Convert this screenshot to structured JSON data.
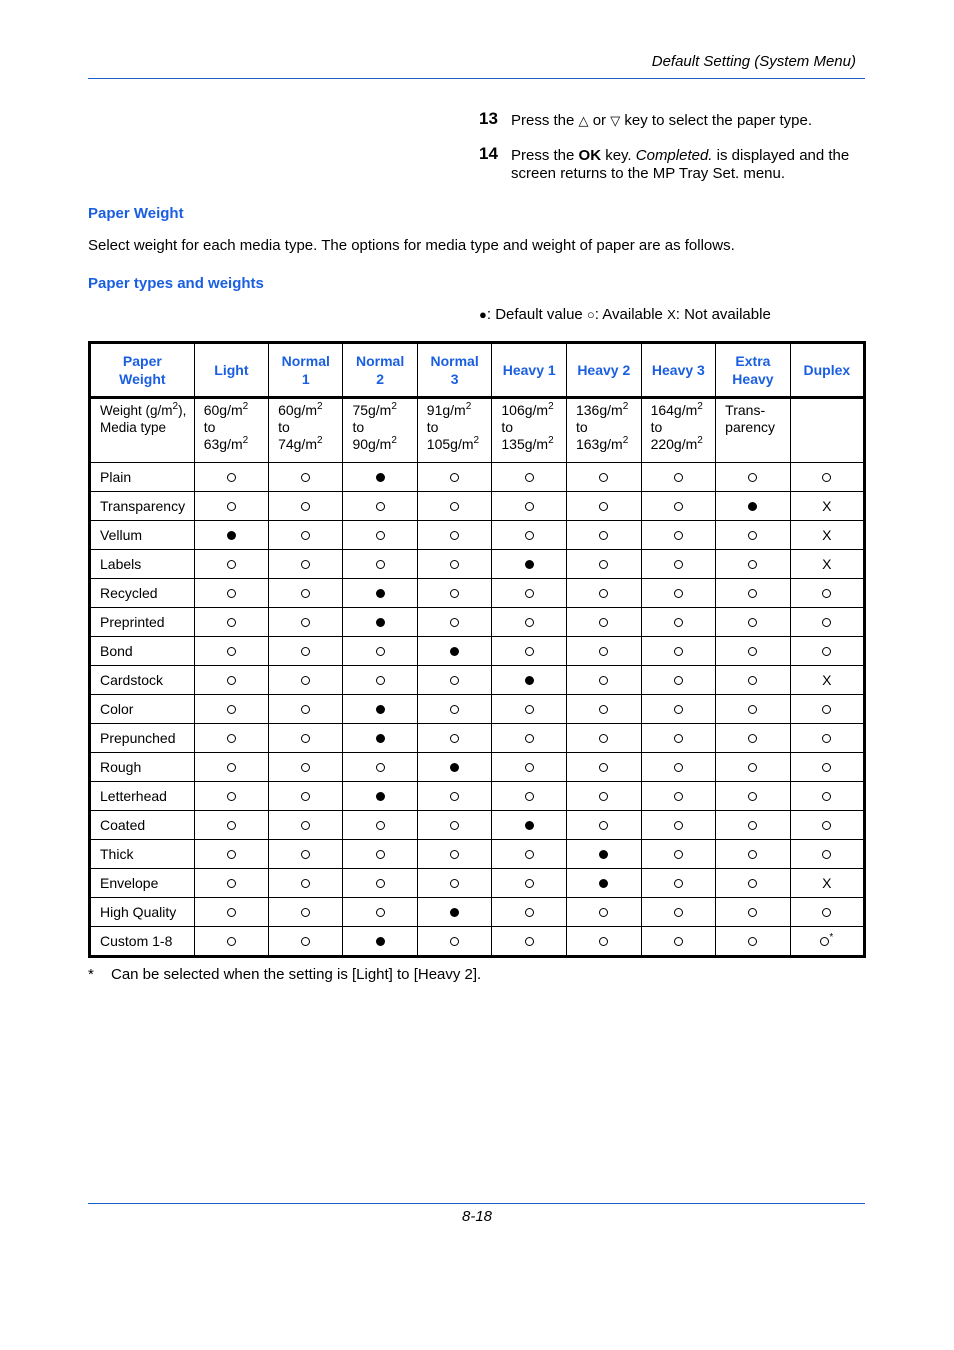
{
  "header": {
    "title": "Default Setting (System Menu)"
  },
  "steps": [
    {
      "num": "13",
      "before": "Press the ",
      "up_key": "△",
      "mid": " or ",
      "down_key": "▽",
      "after": " key to select the paper type."
    },
    {
      "num": "14",
      "before": "Press the ",
      "ok": "OK",
      "mid": " key. ",
      "completed": "Completed.",
      "after": " is displayed and the screen returns to the MP Tray Set. menu."
    }
  ],
  "sections": {
    "paper_weight_heading": "Paper Weight",
    "intro": "Select weight for each media type. The options for media type and weight of paper are as follows.",
    "table_heading": "Paper types and weights"
  },
  "legend": {
    "default_symbol": "●",
    "default_label": ": Default value ",
    "available_symbol": "○",
    "available_label": ": Available ",
    "na_symbol": "X",
    "na_label": ": Not available"
  },
  "table": {
    "headers": [
      [
        "Paper",
        "Weight"
      ],
      [
        "Light"
      ],
      [
        "Normal",
        "1"
      ],
      [
        "Normal",
        "2"
      ],
      [
        "Normal",
        "3"
      ],
      [
        "Heavy 1"
      ],
      [
        "Heavy 2"
      ],
      [
        "Heavy 3"
      ],
      [
        "Extra",
        "Heavy"
      ],
      [
        "Duplex"
      ]
    ],
    "weights_row": {
      "label_line1": "Weight (g/m",
      "label_sup": "2",
      "label_line1_end": "),",
      "label_line2": "Media type",
      "ranges": [
        {
          "from": "60g/m",
          "to_word": "to",
          "to": "63g/m"
        },
        {
          "from": "60g/m",
          "to_word": "to",
          "to": "74g/m"
        },
        {
          "from": "75g/m",
          "to_word": "to",
          "to": "90g/m"
        },
        {
          "from": "91g/m",
          "to_word": "to",
          "to": "105g/m"
        },
        {
          "from": "106g/m",
          "to_word": "to",
          "to": "135g/m"
        },
        {
          "from": "136g/m",
          "to_word": "to",
          "to": "163g/m"
        },
        {
          "from": "164g/m",
          "to_word": "to",
          "to": "220g/m"
        }
      ],
      "extra_heavy": [
        "Trans-",
        "parency"
      ],
      "duplex": ""
    },
    "rows": [
      {
        "media": "Plain",
        "values": [
          "available",
          "available",
          "default",
          "available",
          "available",
          "available",
          "available",
          "available",
          "available"
        ]
      },
      {
        "media": "Transparency",
        "values": [
          "available",
          "available",
          "available",
          "available",
          "available",
          "available",
          "available",
          "default",
          "not_available"
        ]
      },
      {
        "media": "Vellum",
        "values": [
          "default",
          "available",
          "available",
          "available",
          "available",
          "available",
          "available",
          "available",
          "not_available"
        ]
      },
      {
        "media": "Labels",
        "values": [
          "available",
          "available",
          "available",
          "available",
          "default",
          "available",
          "available",
          "available",
          "not_available"
        ]
      },
      {
        "media": "Recycled",
        "values": [
          "available",
          "available",
          "default",
          "available",
          "available",
          "available",
          "available",
          "available",
          "available"
        ]
      },
      {
        "media": "Preprinted",
        "values": [
          "available",
          "available",
          "default",
          "available",
          "available",
          "available",
          "available",
          "available",
          "available"
        ]
      },
      {
        "media": "Bond",
        "values": [
          "available",
          "available",
          "available",
          "default",
          "available",
          "available",
          "available",
          "available",
          "available"
        ]
      },
      {
        "media": "Cardstock",
        "values": [
          "available",
          "available",
          "available",
          "available",
          "default",
          "available",
          "available",
          "available",
          "not_available"
        ]
      },
      {
        "media": "Color",
        "values": [
          "available",
          "available",
          "default",
          "available",
          "available",
          "available",
          "available",
          "available",
          "available"
        ]
      },
      {
        "media": "Prepunched",
        "values": [
          "available",
          "available",
          "default",
          "available",
          "available",
          "available",
          "available",
          "available",
          "available"
        ]
      },
      {
        "media": "Rough",
        "values": [
          "available",
          "available",
          "available",
          "default",
          "available",
          "available",
          "available",
          "available",
          "available"
        ]
      },
      {
        "media": "Letterhead",
        "values": [
          "available",
          "available",
          "default",
          "available",
          "available",
          "available",
          "available",
          "available",
          "available"
        ]
      },
      {
        "media": "Coated",
        "values": [
          "available",
          "available",
          "available",
          "available",
          "default",
          "available",
          "available",
          "available",
          "available"
        ]
      },
      {
        "media": "Thick",
        "values": [
          "available",
          "available",
          "available",
          "available",
          "available",
          "default",
          "available",
          "available",
          "available"
        ]
      },
      {
        "media": "Envelope",
        "values": [
          "available",
          "available",
          "available",
          "available",
          "available",
          "default",
          "available",
          "available",
          "not_available"
        ]
      },
      {
        "media": "High Quality",
        "values": [
          "available",
          "available",
          "available",
          "default",
          "available",
          "available",
          "available",
          "available",
          "available"
        ]
      },
      {
        "media": "Custom 1-8",
        "values": [
          "available",
          "available",
          "default",
          "available",
          "available",
          "available",
          "available",
          "available",
          "available_footnote"
        ]
      }
    ],
    "na_text": "X",
    "footnote_marker": "*"
  },
  "footnote": {
    "marker": "*",
    "text": "Can be selected when the setting is [Light] to [Heavy 2]."
  },
  "footer": {
    "page": "8-18"
  }
}
